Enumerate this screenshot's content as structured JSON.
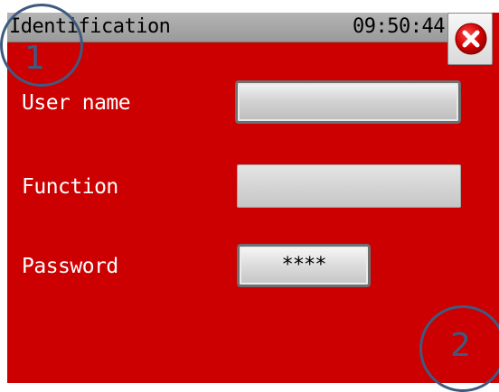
{
  "window": {
    "title": "Identification",
    "clock": "09:50:44"
  },
  "close_button": {
    "icon": "close-icon",
    "color": "#d40000"
  },
  "form": {
    "username_label": "User name",
    "username_value": "",
    "function_label": "Function",
    "function_value": "",
    "password_label": "Password",
    "password_value": "****"
  },
  "markers": {
    "first": "1",
    "second": "2"
  },
  "colors": {
    "background": "#cc0000",
    "titlebar": "#a8a8a8",
    "marker": "#3f5a80"
  }
}
